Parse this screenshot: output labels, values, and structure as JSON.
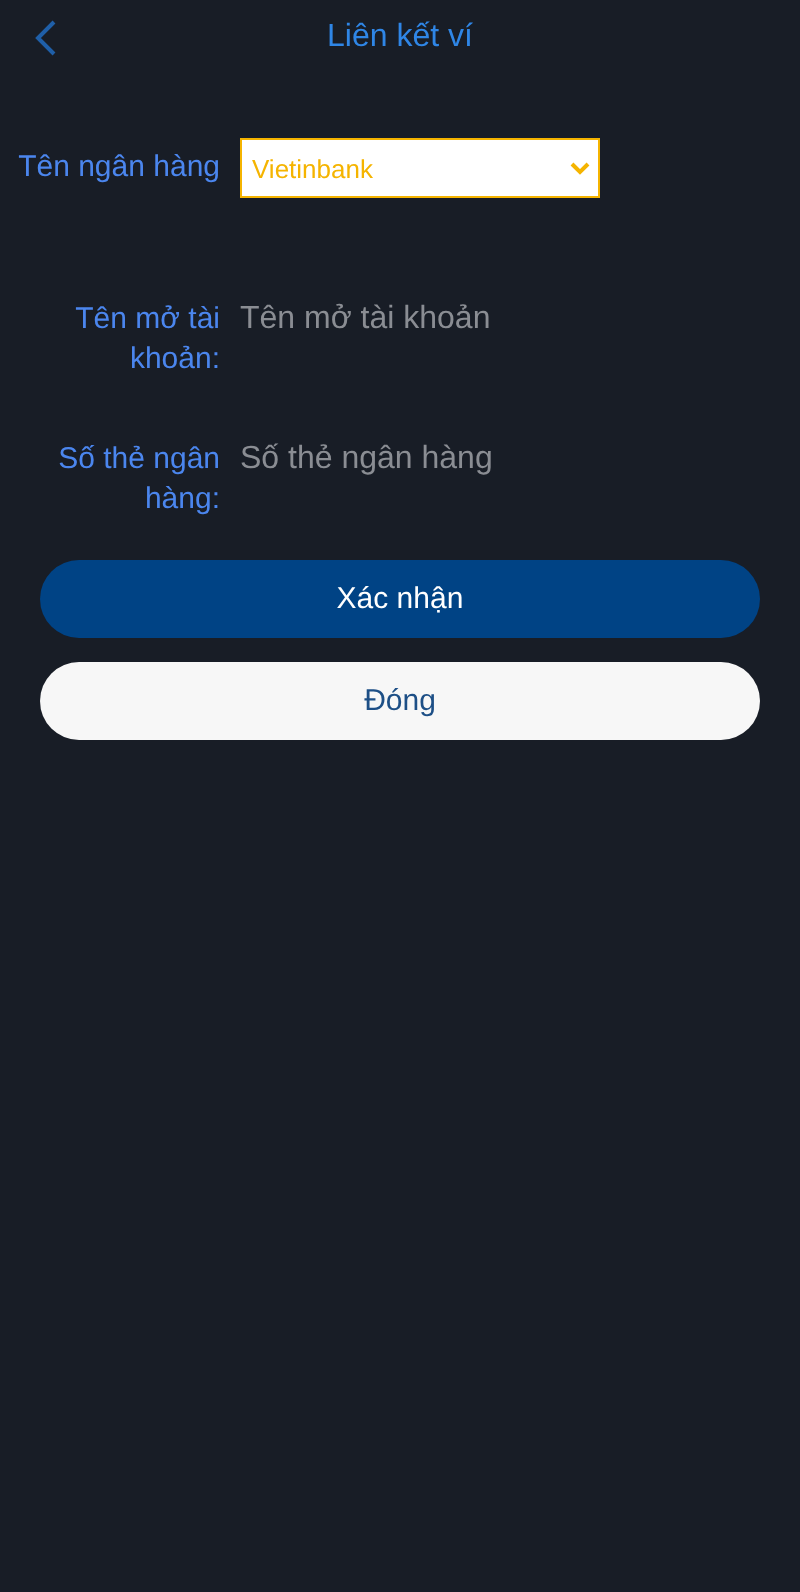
{
  "header": {
    "title": "Liên kết ví"
  },
  "fields": [
    {
      "kind": "select",
      "label": "Tên ngân hàng",
      "value": "Vietinbank"
    },
    {
      "kind": "input",
      "label": "Tên mở tài khoản:",
      "placeholder": "Tên mở tài khoản"
    },
    {
      "kind": "input",
      "label": "Số thẻ ngân hàng:",
      "placeholder": "Số thẻ ngân hàng"
    }
  ],
  "buttons": [
    {
      "kind": "primary",
      "label": "Xác nhận"
    },
    {
      "kind": "secondary",
      "label": "Đóng"
    }
  ]
}
